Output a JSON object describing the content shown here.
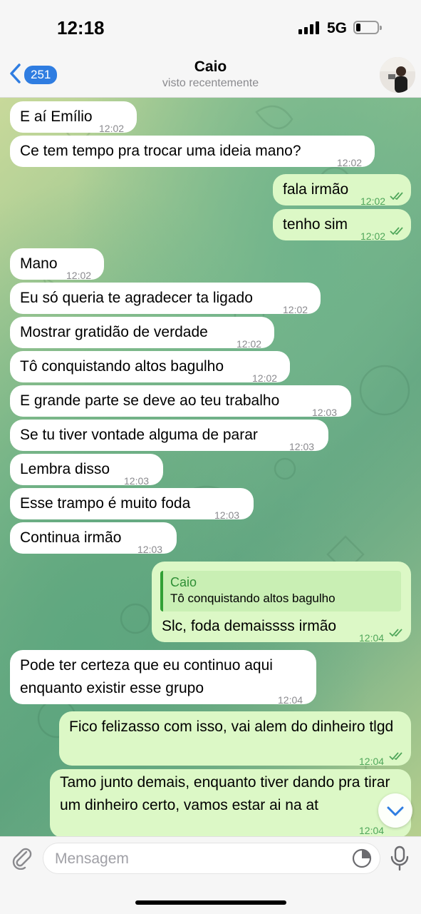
{
  "status": {
    "time": "12:18",
    "network": "5G"
  },
  "nav": {
    "back_count": "251",
    "title": "Caio",
    "subtitle": "visto recentemente"
  },
  "messages": [
    {
      "dir": "in",
      "text": "E aí Emílio",
      "time": "12:02"
    },
    {
      "dir": "in",
      "text": "Ce tem tempo pra trocar uma ideia mano?",
      "time": "12:02"
    },
    {
      "dir": "out",
      "text": "fala irmão",
      "time": "12:02",
      "read": true
    },
    {
      "dir": "out",
      "text": "tenho sim",
      "time": "12:02",
      "read": true
    },
    {
      "dir": "in",
      "text": "Mano",
      "time": "12:02"
    },
    {
      "dir": "in",
      "text": "Eu só queria te agradecer ta ligado",
      "time": "12:02"
    },
    {
      "dir": "in",
      "text": "Mostrar gratidão de verdade",
      "time": "12:02"
    },
    {
      "dir": "in",
      "text": "Tô conquistando altos bagulho",
      "time": "12:02"
    },
    {
      "dir": "in",
      "text": "E grande parte se deve ao teu trabalho",
      "time": "12:03"
    },
    {
      "dir": "in",
      "text": "Se tu tiver vontade alguma de parar",
      "time": "12:03"
    },
    {
      "dir": "in",
      "text": "Lembra disso",
      "time": "12:03"
    },
    {
      "dir": "in",
      "text": "Esse trampo é muito foda",
      "time": "12:03"
    },
    {
      "dir": "in",
      "text": "Continua irmão",
      "time": "12:03"
    },
    {
      "dir": "out",
      "reply_name": "Caio",
      "reply_text": "Tô conquistando altos bagulho",
      "text": "Slc, foda demaissss irmão",
      "time": "12:04",
      "read": true
    },
    {
      "dir": "in",
      "text": "Pode ter certeza que eu continuo aqui enquanto existir esse grupo",
      "time": "12:04"
    },
    {
      "dir": "out",
      "text": "Fico felizasso com isso, vai alem do dinheiro tlgd",
      "time": "12:04",
      "read": true
    },
    {
      "dir": "out",
      "text": "Tamo junto demais, enquanto tiver dando pra tirar um dinheiro certo, vamos estar ai na at",
      "time": "12:04"
    }
  ],
  "composer": {
    "placeholder": "Mensagem"
  },
  "colors": {
    "incoming": "#ffffff",
    "outgoing": "#dcf8c6",
    "accent": "#2f7de1",
    "tick": "#4fa65a"
  },
  "icons": [
    "back-chevron-icon",
    "attach-icon",
    "sticker-icon",
    "mic-icon",
    "scroll-down-icon",
    "read-ticks-icon"
  ]
}
